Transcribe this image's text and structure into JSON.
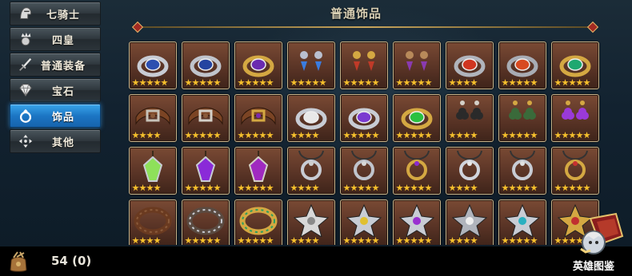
{
  "sidebar": {
    "items": [
      {
        "label": "七骑士",
        "icon": "knight-helmet-icon",
        "active": false
      },
      {
        "label": "四皇",
        "icon": "crowned-head-icon",
        "active": false
      },
      {
        "label": "普通装备",
        "icon": "sword-icon",
        "active": false
      },
      {
        "label": "宝石",
        "icon": "gem-icon",
        "active": false
      },
      {
        "label": "饰品",
        "icon": "ring-icon",
        "active": true
      },
      {
        "label": "其他",
        "icon": "four-arrows-icon",
        "active": false
      }
    ]
  },
  "header": {
    "title": "普通饰品"
  },
  "grid": {
    "rows": [
      [
        {
          "name": "ring-blue-silver",
          "stars": 5
        },
        {
          "name": "ring-blue-silver-2",
          "stars": 5
        },
        {
          "name": "ring-purple-gold",
          "stars": 5
        },
        {
          "name": "earrings-blue",
          "stars": 5
        },
        {
          "name": "earrings-red-gold",
          "stars": 5
        },
        {
          "name": "earrings-purple",
          "stars": 5
        },
        {
          "name": "ring-red-triple",
          "stars": 4
        },
        {
          "name": "ring-red-triple-2",
          "stars": 5
        },
        {
          "name": "ring-green-gold",
          "stars": 5
        }
      ],
      [
        {
          "name": "belt-brown",
          "stars": 4
        },
        {
          "name": "belt-brown-2",
          "stars": 5
        },
        {
          "name": "belt-purple",
          "stars": 5
        },
        {
          "name": "ring-silver",
          "stars": 4
        },
        {
          "name": "ring-purple-silver",
          "stars": 5
        },
        {
          "name": "ring-green-gold-2",
          "stars": 5
        },
        {
          "name": "earrings-clover-black",
          "stars": 4
        },
        {
          "name": "earrings-clover-green",
          "stars": 5
        },
        {
          "name": "earrings-clover-purple",
          "stars": 5
        }
      ],
      [
        {
          "name": "pendant-green",
          "stars": 4
        },
        {
          "name": "pendant-purple",
          "stars": 5
        },
        {
          "name": "pendant-purple-2",
          "stars": 5
        },
        {
          "name": "necklace-loop",
          "stars": 4
        },
        {
          "name": "necklace-hook",
          "stars": 5
        },
        {
          "name": "necklace-purple-ornate",
          "stars": 5
        },
        {
          "name": "necklace-silver-knot",
          "stars": 4
        },
        {
          "name": "necklace-silver-knot-2",
          "stars": 5
        },
        {
          "name": "necklace-red-ornate",
          "stars": 5
        }
      ],
      [
        {
          "name": "bracelet-brown",
          "stars": 4
        },
        {
          "name": "bracelet-spiked",
          "stars": 5
        },
        {
          "name": "bracelet-green",
          "stars": 5
        },
        {
          "name": "amulet-star",
          "stars": 4
        },
        {
          "name": "amulet-star-yellow",
          "stars": 5
        },
        {
          "name": "amulet-purple",
          "stars": 5
        },
        {
          "name": "amulet-triangle",
          "stars": 4
        },
        {
          "name": "amulet-teal",
          "stars": 5
        },
        {
          "name": "amulet-gold",
          "stars": 5
        }
      ]
    ]
  },
  "footer": {
    "count_text": "54 (0)",
    "codex_label": "英雄图鉴"
  },
  "colors": {
    "tile_bg": "#5a3426",
    "tile_border": "#c8b38a",
    "star": "#f6c02c",
    "active_tab": "#1c76c4"
  }
}
